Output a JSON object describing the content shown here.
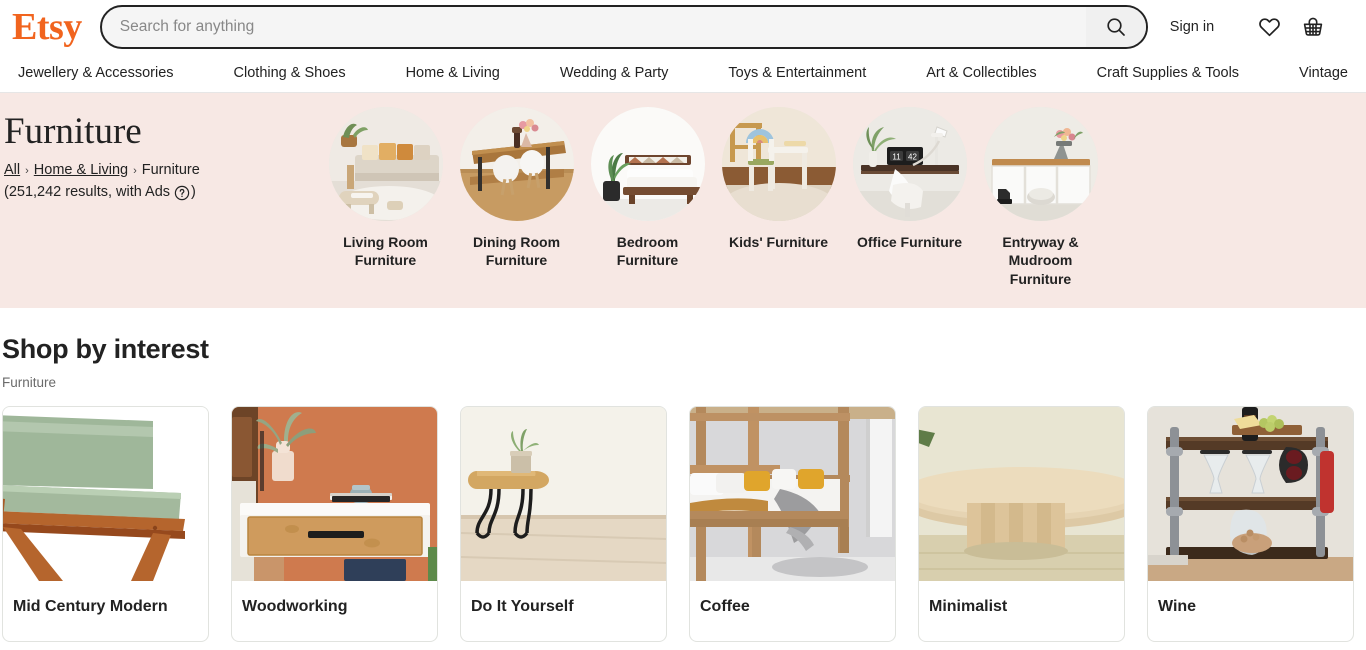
{
  "header": {
    "logo_text": "Etsy",
    "search": {
      "placeholder": "Search for anything",
      "value": "",
      "icon": "search-icon",
      "button_label": ""
    },
    "sign_in_label": "Sign in",
    "favorites_icon": "heart-icon",
    "cart_icon": "basket-icon"
  },
  "nav": {
    "items": [
      {
        "label": "Jewellery & Accessories"
      },
      {
        "label": "Clothing & Shoes"
      },
      {
        "label": "Home & Living"
      },
      {
        "label": "Wedding & Party"
      },
      {
        "label": "Toys & Entertainment"
      },
      {
        "label": "Art & Collectibles"
      },
      {
        "label": "Craft Supplies & Tools"
      },
      {
        "label": "Vintage"
      }
    ]
  },
  "banner": {
    "background_color": "#f7e8e4",
    "title": "Furniture",
    "breadcrumb": {
      "all_label": "All",
      "parent_label": "Home & Living",
      "current_label": "Furniture",
      "separator": "›"
    },
    "results": {
      "prefix": "(251,242 results, with Ads",
      "suffix": ")",
      "count_text": "251,242",
      "help_icon": "question-circle-icon"
    },
    "categories": [
      {
        "label": "Living Room Furniture",
        "icon": "living-room-photo"
      },
      {
        "label": "Dining Room Furniture",
        "icon": "dining-room-photo"
      },
      {
        "label": "Bedroom Furniture",
        "icon": "bedroom-photo"
      },
      {
        "label": "Kids' Furniture",
        "icon": "kids-photo"
      },
      {
        "label": "Office Furniture",
        "icon": "office-photo"
      },
      {
        "label": "Entryway & Mudroom Furniture",
        "icon": "entryway-photo"
      }
    ]
  },
  "shop_by_interest": {
    "title": "Shop by interest",
    "subtitle": "Furniture",
    "cards": [
      {
        "label": "Mid Century Modern",
        "image": "mid-century-chair-photo"
      },
      {
        "label": "Woodworking",
        "image": "nightstand-photo"
      },
      {
        "label": "Do It Yourself",
        "image": "hairpin-table-photo"
      },
      {
        "label": "Coffee",
        "image": "canopy-bed-photo"
      },
      {
        "label": "Minimalist",
        "image": "round-table-photo"
      },
      {
        "label": "Wine",
        "image": "wine-cart-photo"
      }
    ]
  },
  "colors": {
    "brand_orange": "#f1641e",
    "banner_pink": "#f7e8e4",
    "text_dark": "#222222",
    "muted": "#6b6b6b"
  }
}
